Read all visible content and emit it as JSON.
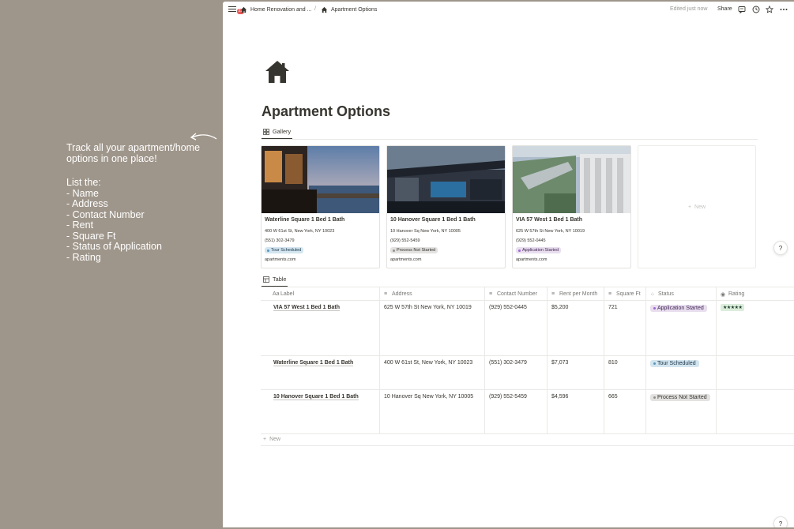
{
  "note": {
    "lines_top": [
      "Track all your apartment/home",
      "options in one place!"
    ],
    "lines_list": [
      "List the:",
      "- Name",
      "- Address",
      "- Contact Number",
      "- Rent",
      "- Square Ft",
      "- Status of Application",
      "- Rating"
    ]
  },
  "topbar": {
    "badge": "22",
    "breadcrumb_parent": "Home Renovation and ...",
    "separator": "/",
    "breadcrumb_current": "Apartment Options",
    "edited": "Edited just now",
    "share": "Share"
  },
  "page": {
    "title": "Apartment Options",
    "gallery_tab": "Gallery",
    "table_tab": "Table"
  },
  "gallery": {
    "cards": [
      {
        "title": "Waterline Square 1 Bed 1 Bath",
        "address": "400 W 61st St, New York, NY 10023",
        "phone": "(551) 302-3479",
        "status": "Tour Scheduled",
        "site": "apartments.com"
      },
      {
        "title": "10 Hanover Square 1 Bed 1 Bath",
        "address": "10 Hanover Sq New York, NY 10005",
        "phone": "(929) 552-5459",
        "status": "Process Not Started",
        "site": "apartments.com"
      },
      {
        "title": "VIA 57 West 1 Bed 1 Bath",
        "address": "625 W 57th St New York, NY 10019",
        "phone": "(929) 552-0445",
        "status": "Application Started",
        "site": "apartments.com"
      }
    ],
    "new_label": "New"
  },
  "table": {
    "headers": [
      "Label",
      "Address",
      "Contact Number",
      "Rent per Month",
      "Square Ft",
      "Status",
      "Rating"
    ],
    "rows": [
      {
        "label": "VIA 57 West 1 Bed 1 Bath",
        "address": "625 W 57th St New York, NY 10019",
        "phone": "(929) 552-0445",
        "rent": "$5,200",
        "sqft": "721",
        "status": "Application Started",
        "rating": "★★★★★"
      },
      {
        "label": "Waterline Square 1 Bed 1 Bath",
        "address": "400 W 61st St, New York, NY 10023",
        "phone": "(551) 302-3479",
        "rent": "$7,073",
        "sqft": "810",
        "status": "Tour Scheduled",
        "rating": ""
      },
      {
        "label": "10 Hanover Square 1 Bed 1 Bath",
        "address": "10 Hanover Sq New York, NY 10005",
        "phone": "(929) 552-5459",
        "rent": "$4,596",
        "sqft": "665",
        "status": "Process Not Started",
        "rating": ""
      }
    ],
    "new_label": "New"
  },
  "status_colors": {
    "Tour Scheduled": {
      "bg": "#d3e5ef",
      "fg": "#183347",
      "dot": "#5b97bd"
    },
    "Process Not Started": {
      "bg": "#e3e2e0",
      "fg": "#32302c",
      "dot": "#91918e"
    },
    "Application Started": {
      "bg": "#e8deee",
      "fg": "#412454",
      "dot": "#9d68d3"
    }
  },
  "help_label": "?"
}
